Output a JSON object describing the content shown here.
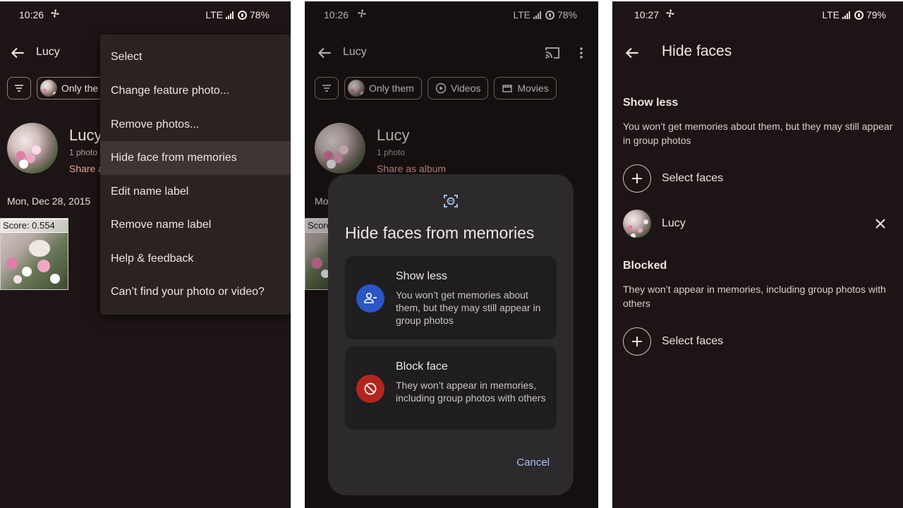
{
  "panel1": {
    "status": {
      "time": "10:26",
      "network": "LTE",
      "battery": "78%"
    },
    "header": {
      "title": "Lucy"
    },
    "chips": {
      "only_them": "Only the"
    },
    "person": {
      "name": "Lucy",
      "count": "1 photo",
      "share": "Share a"
    },
    "date": "Mon, Dec 28, 2015",
    "photo": {
      "score": "Score: 0.554"
    },
    "menu": {
      "items": [
        "Select",
        "Change feature photo...",
        "Remove photos...",
        "Hide face from memories",
        "Edit name label",
        "Remove name label",
        "Help & feedback",
        "Can’t find your photo or video?"
      ]
    }
  },
  "panel2": {
    "status": {
      "time": "10:26",
      "network": "LTE",
      "battery": "78%"
    },
    "header": {
      "title": "Lucy"
    },
    "chips": {
      "only_them": "Only them",
      "videos": "Videos",
      "movies": "Movies"
    },
    "person": {
      "name": "Lucy",
      "count": "1 photo",
      "share": "Share as album"
    },
    "date_partial": "Mo",
    "score_partial": "Score",
    "dialog": {
      "title": "Hide faces from memories",
      "show_less": {
        "title": "Show less",
        "desc": "You won’t get memories about them, but they may still appear in group photos"
      },
      "block": {
        "title": "Block face",
        "desc": "They won’t appear in memories, including group photos with others"
      },
      "cancel": "Cancel"
    },
    "colors": {
      "show_less_icon": "#2a56c6",
      "block_icon": "#b3261e",
      "link": "#a7c0f5"
    }
  },
  "panel3": {
    "status": {
      "time": "10:27",
      "network": "LTE",
      "battery": "79%"
    },
    "header": {
      "title": "Hide faces"
    },
    "show_less": {
      "heading": "Show less",
      "desc": "You won’t get memories about them, but they may still appear in group photos",
      "select": "Select faces",
      "person": "Lucy"
    },
    "blocked": {
      "heading": "Blocked",
      "desc": "They won’t appear in memories, including group photos with others",
      "select": "Select faces"
    }
  }
}
